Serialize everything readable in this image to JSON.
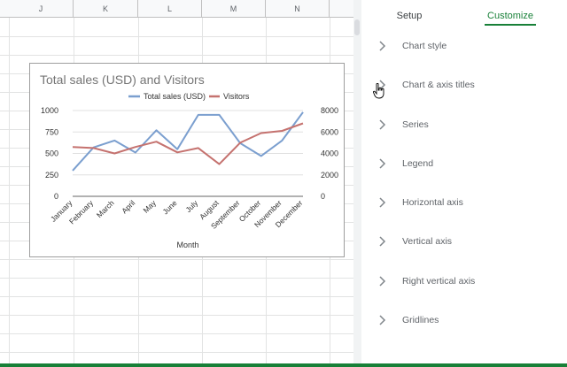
{
  "sheet": {
    "columns": [
      "J",
      "K",
      "L",
      "M",
      "N"
    ]
  },
  "chart_data": {
    "type": "line",
    "title": "Total sales (USD) and Visitors",
    "categories": [
      "January",
      "February",
      "March",
      "April",
      "May",
      "June",
      "July",
      "August",
      "September",
      "October",
      "November",
      "December"
    ],
    "series": [
      {
        "name": "Total sales (USD)",
        "axis": "left",
        "color": "#7b9fcf",
        "values": [
          300,
          570,
          650,
          510,
          770,
          550,
          950,
          950,
          620,
          470,
          650,
          980
        ]
      },
      {
        "name": "Visitors",
        "axis": "right",
        "color": "#c5726f",
        "values": [
          4600,
          4500,
          4000,
          4600,
          5100,
          4100,
          4500,
          3000,
          5000,
          5900,
          6100,
          6800
        ]
      }
    ],
    "xlabel": "Month",
    "ylabel": "",
    "ylim": [
      0,
      1000
    ],
    "y_ticks": [
      "1000",
      "750",
      "500",
      "250",
      "0"
    ],
    "y2lim": [
      0,
      8000
    ],
    "y2_ticks": [
      "8000",
      "6000",
      "4000",
      "2000",
      "0"
    ],
    "legend": "top",
    "grid": true
  },
  "panel": {
    "tabs": [
      {
        "label": "Setup",
        "active": false
      },
      {
        "label": "Customize",
        "active": true
      }
    ],
    "sections": [
      {
        "label": "Chart style",
        "icon": "chevron-right-icon"
      },
      {
        "label": "Chart & axis titles",
        "icon": "chevron-right-icon"
      },
      {
        "label": "Series",
        "icon": "chevron-right-icon"
      },
      {
        "label": "Legend",
        "icon": "chevron-right-icon"
      },
      {
        "label": "Horizontal axis",
        "icon": "chevron-right-icon"
      },
      {
        "label": "Vertical axis",
        "icon": "chevron-right-icon"
      },
      {
        "label": "Right vertical axis",
        "icon": "chevron-right-icon"
      },
      {
        "label": "Gridlines",
        "icon": "chevron-right-icon"
      }
    ],
    "accent_color": "#188038"
  },
  "cursor": {
    "icon": "hand-pointer-icon"
  }
}
